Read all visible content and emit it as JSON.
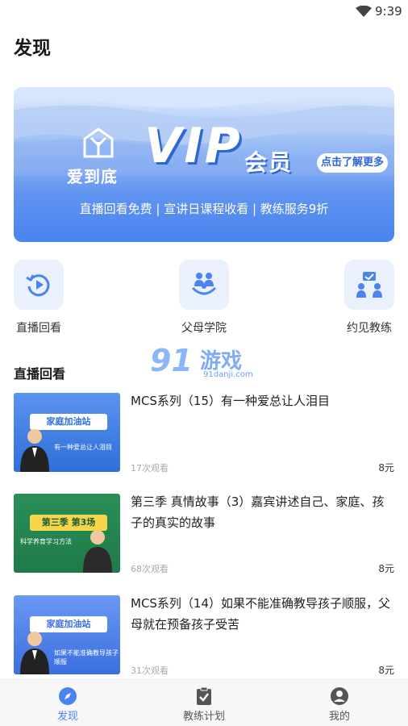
{
  "status_bar": {
    "time": "9:39"
  },
  "page": {
    "title": "发现"
  },
  "banner": {
    "brand": "爱到底",
    "vip": "VIP",
    "member": "会员",
    "more": "点击了解更多",
    "subtitle": "直播回看免费 | 宣讲日课程收看 | 教练服务9折"
  },
  "quick_actions": [
    {
      "label": "直播回看",
      "icon": "replay-icon"
    },
    {
      "label": "父母学院",
      "icon": "family-icon"
    },
    {
      "label": "约见教练",
      "icon": "meeting-icon"
    }
  ],
  "watermark": {
    "brand": "91",
    "text": "游戏",
    "url": "91danji.com"
  },
  "section": {
    "title": "直播回看"
  },
  "courses": [
    {
      "title": "MCS系列（15）有一种爱总让人泪目",
      "views": "17次观看",
      "price": "8元",
      "thumb": {
        "head": "家庭加油站",
        "caption": "有一种爱总让人泪目",
        "bg": "#2f6fd8"
      }
    },
    {
      "title": "第三季 真情故事（3）嘉宾讲述自己、家庭、孩子的真实的故事",
      "views": "68次观看",
      "price": "8元",
      "thumb": {
        "head": "第三季 第3场",
        "caption": "科学养育学习方法",
        "bg": "#1f7a4a"
      }
    },
    {
      "title": "MCS系列（14）如果不能准确教导孩子顺服，父母就在预备孩子受苦",
      "views": "31次观看",
      "price": "8元",
      "thumb": {
        "head": "家庭加油站",
        "caption": "如果不能准确教导孩子顺服",
        "bg": "#3a6fe0"
      }
    }
  ],
  "tabbar": {
    "tabs": [
      {
        "label": "发现",
        "active": true
      },
      {
        "label": "教练计划",
        "active": false
      },
      {
        "label": "我的",
        "active": false
      }
    ]
  },
  "colors": {
    "accent": "#4a84ef",
    "banner_light": "#e6efff",
    "quick_bg": "#eaf1fd"
  }
}
